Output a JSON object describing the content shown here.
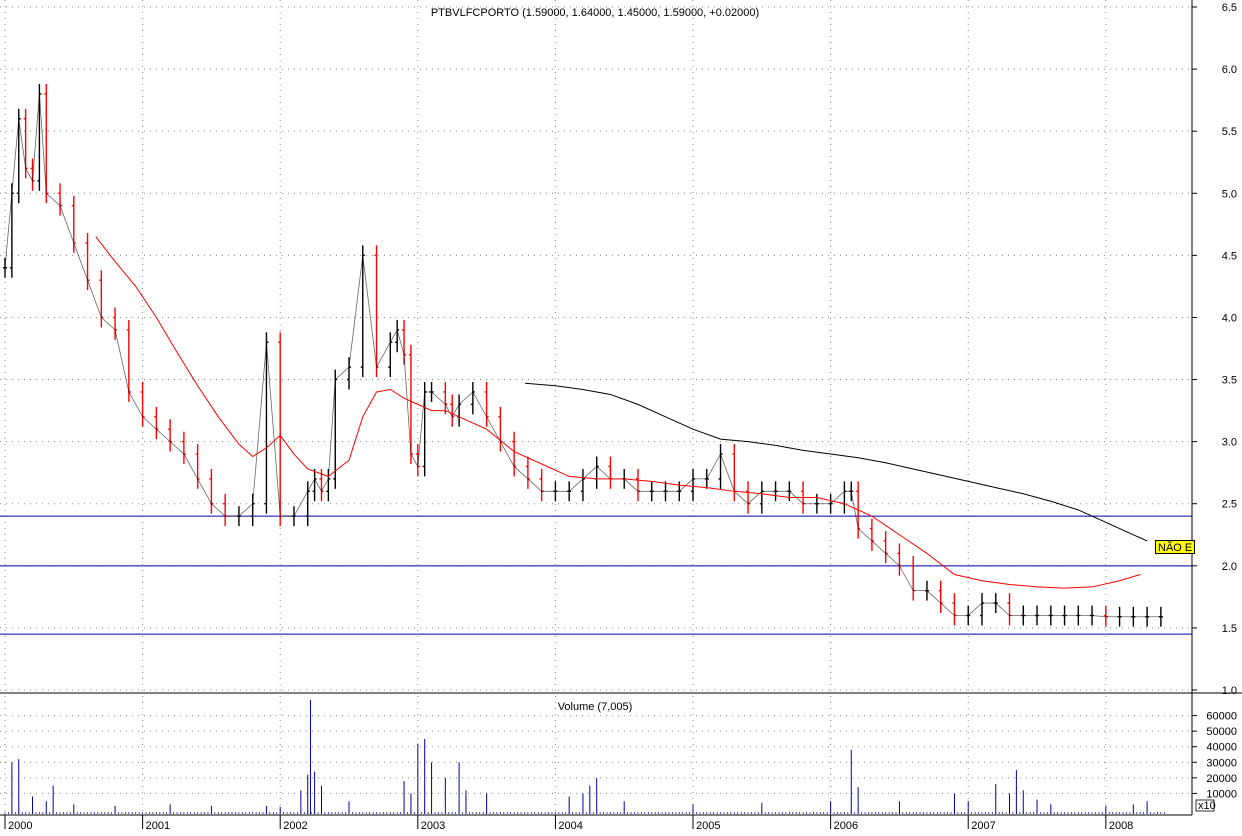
{
  "chart_data": [
    {
      "type": "candlestick",
      "title": "PTBVLFCPORTO (1.59000, 1.64000, 1.45000, 1.59000, +0.02000)",
      "ylim": [
        1.0,
        6.5
      ],
      "yticks": [
        "6.5",
        "6.0",
        "5.5",
        "5.0",
        "4.5",
        "4.0",
        "3.5",
        "3.0",
        "2.5",
        "2.0",
        "1.5",
        "1.0"
      ],
      "xticks": [
        "2000",
        "2001",
        "2002",
        "2003",
        "2004",
        "2005",
        "2006",
        "2007",
        "2008"
      ],
      "grid": true,
      "series": [
        {
          "kind": "close-price",
          "color": "#000000",
          "up_color": "#000000",
          "down_color": "#ff0000",
          "x": [
            2000.0,
            2000.05,
            2000.1,
            2000.15,
            2000.2,
            2000.25,
            2000.3,
            2000.4,
            2000.5,
            2000.6,
            2000.7,
            2000.8,
            2000.9,
            2001.0,
            2001.1,
            2001.2,
            2001.3,
            2001.4,
            2001.5,
            2001.6,
            2001.7,
            2001.8,
            2001.9,
            2002.0,
            2002.1,
            2002.2,
            2002.25,
            2002.3,
            2002.35,
            2002.4,
            2002.5,
            2002.6,
            2002.7,
            2002.8,
            2002.85,
            2002.9,
            2002.95,
            2003.0,
            2003.05,
            2003.1,
            2003.2,
            2003.25,
            2003.3,
            2003.4,
            2003.5,
            2003.6,
            2003.7,
            2003.8,
            2003.9,
            2004.0,
            2004.1,
            2004.2,
            2004.3,
            2004.4,
            2004.5,
            2004.6,
            2004.7,
            2004.8,
            2004.9,
            2005.0,
            2005.1,
            2005.2,
            2005.3,
            2005.4,
            2005.5,
            2005.6,
            2005.7,
            2005.8,
            2005.9,
            2006.0,
            2006.1,
            2006.15,
            2006.2,
            2006.3,
            2006.4,
            2006.5,
            2006.6,
            2006.7,
            2006.8,
            2006.9,
            2007.0,
            2007.1,
            2007.2,
            2007.3,
            2007.4,
            2007.5,
            2007.6,
            2007.7,
            2007.8,
            2007.9,
            2008.0,
            2008.1,
            2008.2,
            2008.3,
            2008.4
          ],
          "values": [
            4.4,
            5.0,
            5.6,
            5.2,
            5.1,
            5.8,
            5.0,
            4.9,
            4.6,
            4.3,
            4.0,
            3.9,
            3.4,
            3.2,
            3.1,
            3.0,
            2.9,
            2.7,
            2.5,
            2.4,
            2.4,
            2.5,
            3.8,
            2.4,
            2.4,
            2.6,
            2.7,
            2.6,
            2.7,
            3.5,
            3.6,
            4.5,
            3.6,
            3.8,
            3.9,
            3.7,
            2.9,
            2.8,
            3.4,
            3.4,
            3.3,
            3.2,
            3.3,
            3.4,
            3.2,
            3.0,
            2.8,
            2.7,
            2.6,
            2.6,
            2.6,
            2.7,
            2.8,
            2.7,
            2.7,
            2.6,
            2.6,
            2.6,
            2.6,
            2.7,
            2.7,
            2.9,
            2.6,
            2.5,
            2.6,
            2.6,
            2.6,
            2.5,
            2.5,
            2.5,
            2.6,
            2.6,
            2.3,
            2.2,
            2.1,
            2.0,
            1.8,
            1.8,
            1.7,
            1.6,
            1.6,
            1.7,
            1.7,
            1.6,
            1.6,
            1.6,
            1.6,
            1.6,
            1.6,
            1.6,
            1.59,
            1.59,
            1.59,
            1.59,
            1.59
          ]
        },
        {
          "kind": "moving-average",
          "color": "#ff0000",
          "x": [
            2000.66,
            2000.8,
            2000.95,
            2001.1,
            2001.25,
            2001.4,
            2001.55,
            2001.7,
            2001.8,
            2001.9,
            2002.0,
            2002.1,
            2002.2,
            2002.35,
            2002.5,
            2002.6,
            2002.7,
            2002.8,
            2002.9,
            2003.0,
            2003.1,
            2003.2,
            2003.3,
            2003.5,
            2003.7,
            2003.9,
            2004.1,
            2004.3,
            2004.5,
            2004.7,
            2004.9,
            2005.1,
            2005.3,
            2005.5,
            2005.7,
            2005.9,
            2006.1,
            2006.3,
            2006.5,
            2006.7,
            2006.9,
            2007.1,
            2007.3,
            2007.5,
            2007.7,
            2007.9,
            2008.1,
            2008.25
          ],
          "values": [
            4.65,
            4.45,
            4.25,
            4.0,
            3.72,
            3.45,
            3.2,
            2.98,
            2.88,
            2.95,
            3.05,
            2.9,
            2.78,
            2.72,
            2.85,
            3.2,
            3.4,
            3.42,
            3.35,
            3.3,
            3.25,
            3.25,
            3.2,
            3.1,
            2.92,
            2.82,
            2.72,
            2.7,
            2.7,
            2.68,
            2.65,
            2.63,
            2.6,
            2.58,
            2.55,
            2.55,
            2.5,
            2.4,
            2.25,
            2.1,
            1.93,
            1.88,
            1.85,
            1.83,
            1.82,
            1.83,
            1.88,
            1.93
          ]
        },
        {
          "kind": "moving-average",
          "color": "#000000",
          "x": [
            2003.78,
            2004.0,
            2004.2,
            2004.4,
            2004.6,
            2004.8,
            2005.0,
            2005.2,
            2005.4,
            2005.6,
            2005.8,
            2006.0,
            2006.2,
            2006.4,
            2006.6,
            2006.8,
            2007.0,
            2007.2,
            2007.4,
            2007.6,
            2007.8,
            2008.0,
            2008.2,
            2008.3
          ],
          "values": [
            3.47,
            3.45,
            3.42,
            3.38,
            3.3,
            3.2,
            3.1,
            3.02,
            3.0,
            2.97,
            2.93,
            2.9,
            2.87,
            2.83,
            2.78,
            2.73,
            2.68,
            2.63,
            2.58,
            2.52,
            2.45,
            2.35,
            2.25,
            2.2
          ]
        }
      ],
      "horizontal_lines": [
        2.4,
        2.0,
        1.45
      ],
      "tag": "NÃO E"
    },
    {
      "type": "bar",
      "title": "Volume (7,005)",
      "ylim": [
        0,
        70000
      ],
      "yticks": [
        "60000",
        "50000",
        "40000",
        "30000",
        "20000",
        "10000"
      ],
      "scale_label": "x10",
      "color": "#0000aa",
      "x": [
        2000.05,
        2000.1,
        2000.2,
        2000.3,
        2000.35,
        2000.5,
        2000.8,
        2001.2,
        2001.5,
        2001.9,
        2002.0,
        2002.15,
        2002.2,
        2002.22,
        2002.25,
        2002.3,
        2002.5,
        2002.9,
        2002.95,
        2003.0,
        2003.05,
        2003.1,
        2003.2,
        2003.3,
        2003.35,
        2003.5,
        2004.1,
        2004.2,
        2004.25,
        2004.3,
        2004.5,
        2005.0,
        2005.5,
        2006.0,
        2006.15,
        2006.2,
        2006.5,
        2006.9,
        2007.0,
        2007.2,
        2007.3,
        2007.35,
        2007.4,
        2007.5,
        2007.6,
        2008.0,
        2008.2,
        2008.3
      ],
      "values": [
        30000,
        32000,
        8000,
        5000,
        15000,
        3000,
        2000,
        3000,
        2000,
        2000,
        1500,
        12000,
        22000,
        70000,
        24000,
        15000,
        5000,
        18000,
        10000,
        42000,
        45000,
        30000,
        20000,
        30000,
        12000,
        10000,
        8000,
        10000,
        15000,
        20000,
        5000,
        3000,
        4000,
        5000,
        38000,
        14000,
        5000,
        10000,
        5000,
        16000,
        10000,
        25000,
        12000,
        6000,
        3000,
        2000,
        3000,
        5000
      ]
    }
  ]
}
